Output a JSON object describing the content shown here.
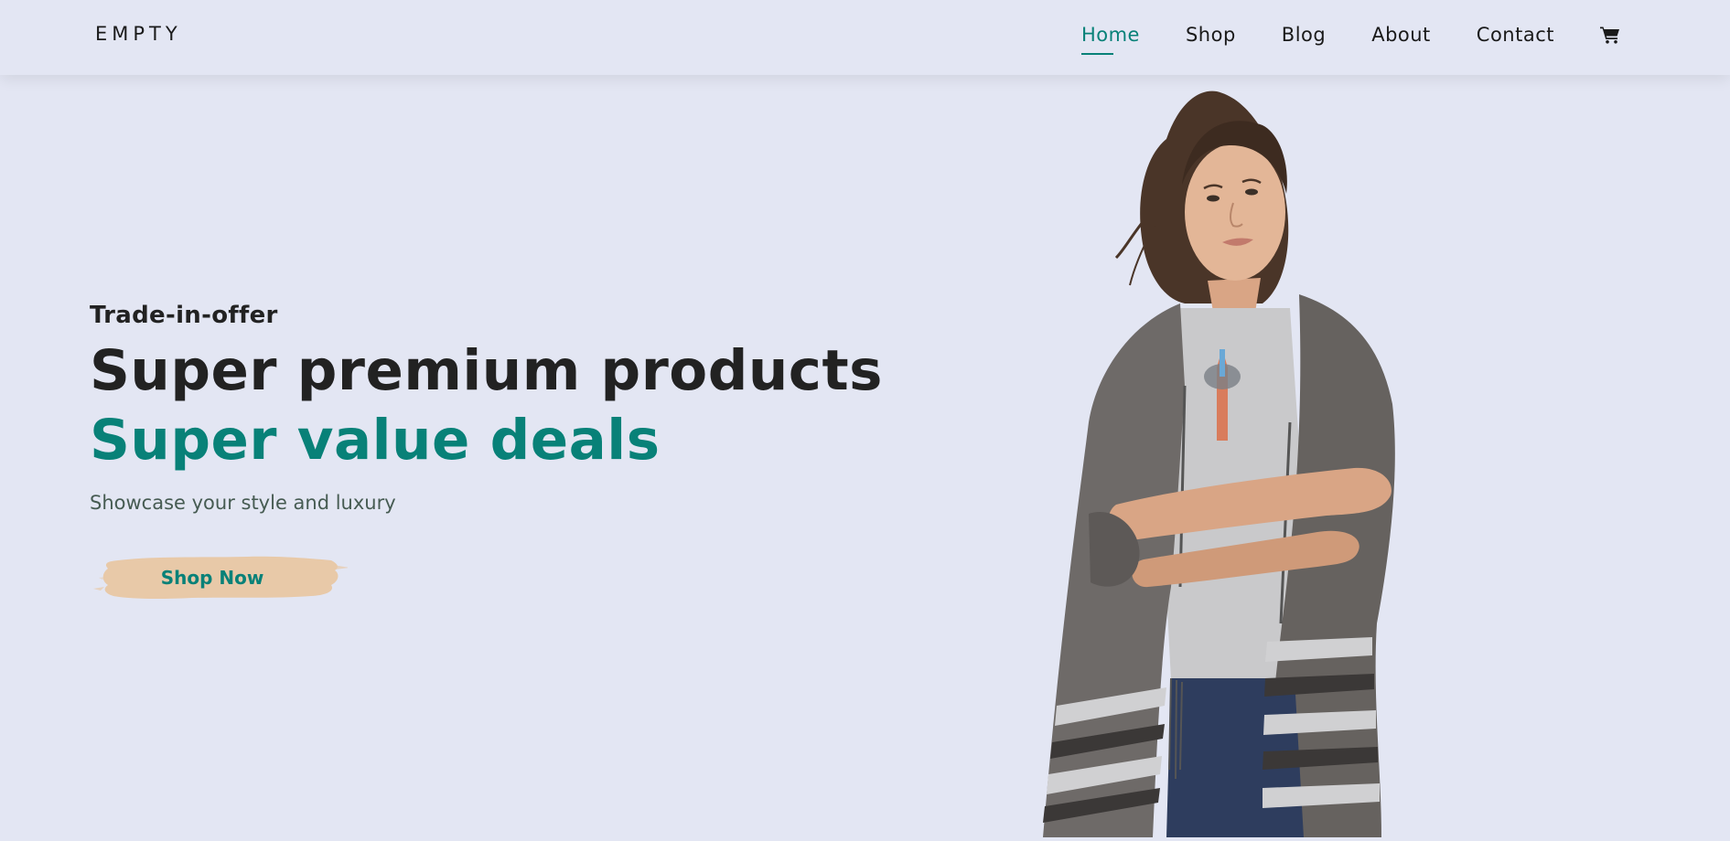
{
  "brand": {
    "logo_text": "EMPTY"
  },
  "nav": {
    "items": [
      {
        "label": "Home",
        "active": true
      },
      {
        "label": "Shop",
        "active": false
      },
      {
        "label": "Blog",
        "active": false
      },
      {
        "label": "About",
        "active": false
      },
      {
        "label": "Contact",
        "active": false
      }
    ],
    "cart_icon": "shopping-cart-icon"
  },
  "hero": {
    "eyebrow": "Trade-in-offer",
    "title_line_1": "Super premium products",
    "title_line_2": "Super value deals",
    "subtitle": "Showcase your style and luxury",
    "cta_label": "Shop Now"
  },
  "colors": {
    "background": "#e3e6f3",
    "accent": "#088178",
    "button_brush": "#e8c9a8",
    "text_dark": "#222222"
  }
}
